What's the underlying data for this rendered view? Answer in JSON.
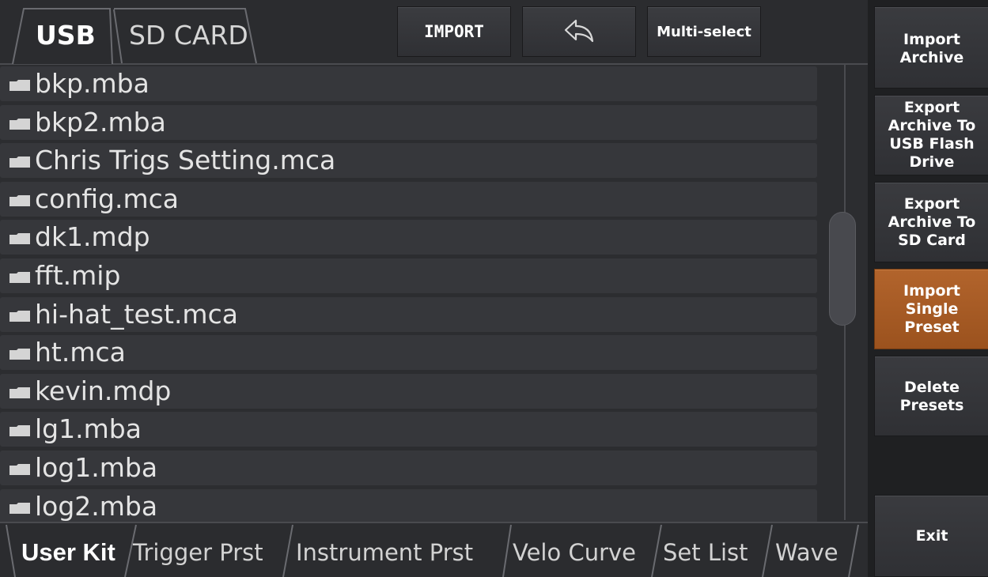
{
  "source_tabs": [
    {
      "label": "USB",
      "active": true
    },
    {
      "label": "SD CARD",
      "active": false
    }
  ],
  "toolbar": {
    "import_label": "IMPORT",
    "back_icon": "back-arrow-icon",
    "multiselect_label": "Multi-select"
  },
  "files": [
    "bkp.mba",
    "bkp2.mba",
    "Chris Trigs Setting.mca",
    "config.mca",
    "dk1.mdp",
    "fft.mip",
    "hi-hat_test.mca",
    "ht.mca",
    "kevin.mdp",
    "lg1.mba",
    "log1.mba",
    "log2.mba"
  ],
  "bottom_tabs": [
    {
      "label": "User Kit",
      "active": true
    },
    {
      "label": "Trigger Prst",
      "active": false
    },
    {
      "label": "Instrument Prst",
      "active": false
    },
    {
      "label": "Velo Curve",
      "active": false
    },
    {
      "label": "Set List",
      "active": false
    },
    {
      "label": "Wave",
      "active": false
    }
  ],
  "side_buttons": {
    "import_archive": "Import\nArchive",
    "export_usb": "Export\nArchive To\nUSB Flash\nDrive",
    "export_sd": "Export\nArchive To\nSD Card",
    "import_single": "Import\nSingle\nPreset",
    "delete_presets": "Delete\nPresets",
    "exit": "Exit"
  },
  "colors": {
    "background": "#2c2d30",
    "row": "#36373b",
    "accent": "#a65a24"
  }
}
